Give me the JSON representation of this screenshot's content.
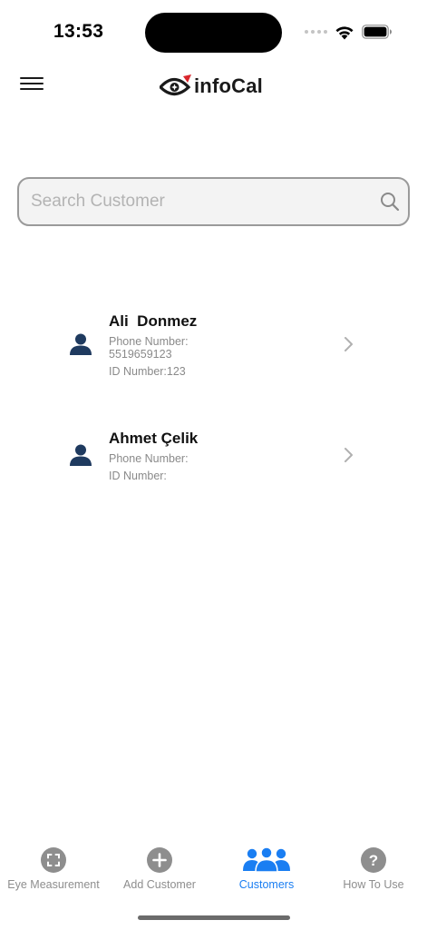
{
  "status_bar": {
    "time": "13:53"
  },
  "header": {
    "menu_icon": "hamburger-menu-icon",
    "logo_text": "infoCal",
    "logo_icon": "eye-logo-icon"
  },
  "search": {
    "placeholder": "Search Customer",
    "value": "",
    "icon": "search-icon"
  },
  "customers": [
    {
      "name": "Ali  Donmez",
      "phone_label": "Phone Number:",
      "phone_value": "5519659123",
      "id_text": "ID Number:123"
    },
    {
      "name": "Ahmet Çelik",
      "phone_label": "Phone Number:",
      "phone_value": "",
      "id_text": "ID Number:"
    }
  ],
  "tab_bar": {
    "tabs": [
      {
        "label": "Eye Measurement",
        "icon": "scan-frame-icon",
        "active": false
      },
      {
        "label": "Add Customer",
        "icon": "plus-circle-icon",
        "active": false
      },
      {
        "label": "Customers",
        "icon": "people-group-icon",
        "active": true
      },
      {
        "label": "How To Use",
        "icon": "question-circle-icon",
        "active": false
      }
    ]
  },
  "colors": {
    "accent": "#1a7ef2",
    "avatar": "#1f3a5f",
    "inactive_tab": "#8e8e8e"
  }
}
